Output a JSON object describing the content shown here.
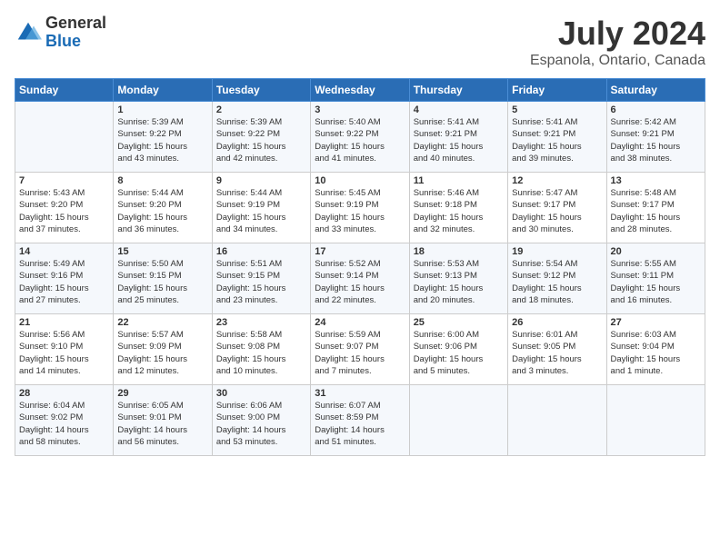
{
  "logo": {
    "general": "General",
    "blue": "Blue"
  },
  "title": "July 2024",
  "location": "Espanola, Ontario, Canada",
  "days_header": [
    "Sunday",
    "Monday",
    "Tuesday",
    "Wednesday",
    "Thursday",
    "Friday",
    "Saturday"
  ],
  "weeks": [
    [
      {
        "day": "",
        "info": ""
      },
      {
        "day": "1",
        "info": "Sunrise: 5:39 AM\nSunset: 9:22 PM\nDaylight: 15 hours\nand 43 minutes."
      },
      {
        "day": "2",
        "info": "Sunrise: 5:39 AM\nSunset: 9:22 PM\nDaylight: 15 hours\nand 42 minutes."
      },
      {
        "day": "3",
        "info": "Sunrise: 5:40 AM\nSunset: 9:22 PM\nDaylight: 15 hours\nand 41 minutes."
      },
      {
        "day": "4",
        "info": "Sunrise: 5:41 AM\nSunset: 9:21 PM\nDaylight: 15 hours\nand 40 minutes."
      },
      {
        "day": "5",
        "info": "Sunrise: 5:41 AM\nSunset: 9:21 PM\nDaylight: 15 hours\nand 39 minutes."
      },
      {
        "day": "6",
        "info": "Sunrise: 5:42 AM\nSunset: 9:21 PM\nDaylight: 15 hours\nand 38 minutes."
      }
    ],
    [
      {
        "day": "7",
        "info": "Sunrise: 5:43 AM\nSunset: 9:20 PM\nDaylight: 15 hours\nand 37 minutes."
      },
      {
        "day": "8",
        "info": "Sunrise: 5:44 AM\nSunset: 9:20 PM\nDaylight: 15 hours\nand 36 minutes."
      },
      {
        "day": "9",
        "info": "Sunrise: 5:44 AM\nSunset: 9:19 PM\nDaylight: 15 hours\nand 34 minutes."
      },
      {
        "day": "10",
        "info": "Sunrise: 5:45 AM\nSunset: 9:19 PM\nDaylight: 15 hours\nand 33 minutes."
      },
      {
        "day": "11",
        "info": "Sunrise: 5:46 AM\nSunset: 9:18 PM\nDaylight: 15 hours\nand 32 minutes."
      },
      {
        "day": "12",
        "info": "Sunrise: 5:47 AM\nSunset: 9:17 PM\nDaylight: 15 hours\nand 30 minutes."
      },
      {
        "day": "13",
        "info": "Sunrise: 5:48 AM\nSunset: 9:17 PM\nDaylight: 15 hours\nand 28 minutes."
      }
    ],
    [
      {
        "day": "14",
        "info": "Sunrise: 5:49 AM\nSunset: 9:16 PM\nDaylight: 15 hours\nand 27 minutes."
      },
      {
        "day": "15",
        "info": "Sunrise: 5:50 AM\nSunset: 9:15 PM\nDaylight: 15 hours\nand 25 minutes."
      },
      {
        "day": "16",
        "info": "Sunrise: 5:51 AM\nSunset: 9:15 PM\nDaylight: 15 hours\nand 23 minutes."
      },
      {
        "day": "17",
        "info": "Sunrise: 5:52 AM\nSunset: 9:14 PM\nDaylight: 15 hours\nand 22 minutes."
      },
      {
        "day": "18",
        "info": "Sunrise: 5:53 AM\nSunset: 9:13 PM\nDaylight: 15 hours\nand 20 minutes."
      },
      {
        "day": "19",
        "info": "Sunrise: 5:54 AM\nSunset: 9:12 PM\nDaylight: 15 hours\nand 18 minutes."
      },
      {
        "day": "20",
        "info": "Sunrise: 5:55 AM\nSunset: 9:11 PM\nDaylight: 15 hours\nand 16 minutes."
      }
    ],
    [
      {
        "day": "21",
        "info": "Sunrise: 5:56 AM\nSunset: 9:10 PM\nDaylight: 15 hours\nand 14 minutes."
      },
      {
        "day": "22",
        "info": "Sunrise: 5:57 AM\nSunset: 9:09 PM\nDaylight: 15 hours\nand 12 minutes."
      },
      {
        "day": "23",
        "info": "Sunrise: 5:58 AM\nSunset: 9:08 PM\nDaylight: 15 hours\nand 10 minutes."
      },
      {
        "day": "24",
        "info": "Sunrise: 5:59 AM\nSunset: 9:07 PM\nDaylight: 15 hours\nand 7 minutes."
      },
      {
        "day": "25",
        "info": "Sunrise: 6:00 AM\nSunset: 9:06 PM\nDaylight: 15 hours\nand 5 minutes."
      },
      {
        "day": "26",
        "info": "Sunrise: 6:01 AM\nSunset: 9:05 PM\nDaylight: 15 hours\nand 3 minutes."
      },
      {
        "day": "27",
        "info": "Sunrise: 6:03 AM\nSunset: 9:04 PM\nDaylight: 15 hours\nand 1 minute."
      }
    ],
    [
      {
        "day": "28",
        "info": "Sunrise: 6:04 AM\nSunset: 9:02 PM\nDaylight: 14 hours\nand 58 minutes."
      },
      {
        "day": "29",
        "info": "Sunrise: 6:05 AM\nSunset: 9:01 PM\nDaylight: 14 hours\nand 56 minutes."
      },
      {
        "day": "30",
        "info": "Sunrise: 6:06 AM\nSunset: 9:00 PM\nDaylight: 14 hours\nand 53 minutes."
      },
      {
        "day": "31",
        "info": "Sunrise: 6:07 AM\nSunset: 8:59 PM\nDaylight: 14 hours\nand 51 minutes."
      },
      {
        "day": "",
        "info": ""
      },
      {
        "day": "",
        "info": ""
      },
      {
        "day": "",
        "info": ""
      }
    ]
  ]
}
